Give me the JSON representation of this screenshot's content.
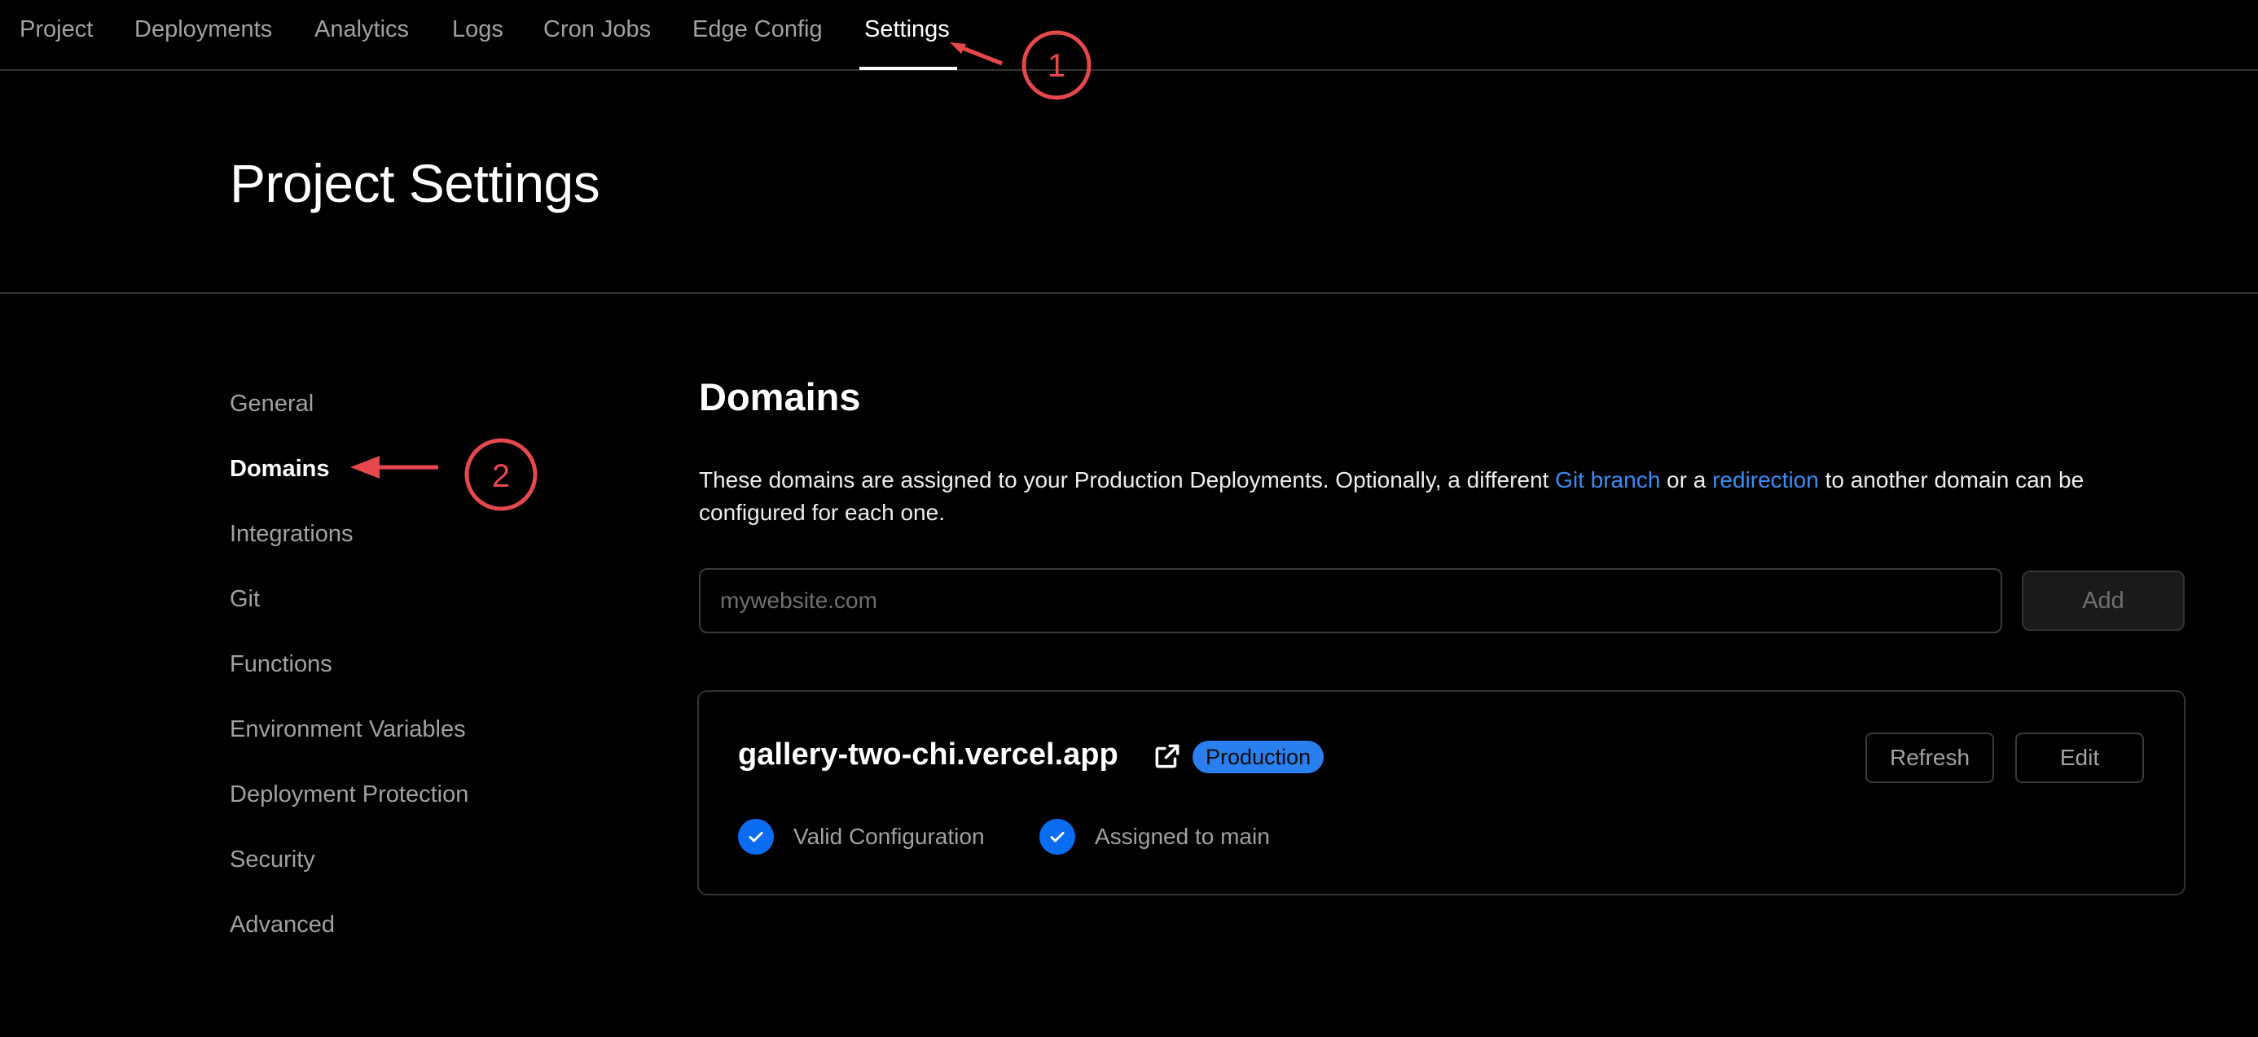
{
  "nav": {
    "tabs": [
      {
        "label": "Project"
      },
      {
        "label": "Deployments"
      },
      {
        "label": "Analytics"
      },
      {
        "label": "Logs"
      },
      {
        "label": "Cron Jobs"
      },
      {
        "label": "Edge Config"
      },
      {
        "label": "Settings",
        "active": true
      }
    ]
  },
  "header": {
    "title": "Project Settings"
  },
  "sidebar": {
    "items": [
      {
        "label": "General"
      },
      {
        "label": "Domains",
        "active": true
      },
      {
        "label": "Integrations"
      },
      {
        "label": "Git"
      },
      {
        "label": "Functions"
      },
      {
        "label": "Environment Variables"
      },
      {
        "label": "Deployment Protection"
      },
      {
        "label": "Security"
      },
      {
        "label": "Advanced"
      }
    ]
  },
  "domains": {
    "title": "Domains",
    "description": {
      "part1": "These domains are assigned to your Production Deployments. Optionally, a different ",
      "link1": "Git branch",
      "part2": " or a ",
      "link2": "redirection",
      "part3": " to another domain can be configured for each one."
    },
    "input_placeholder": "mywebsite.com",
    "add_label": "Add",
    "card": {
      "domain": "gallery-two-chi.vercel.app",
      "badge": "Production",
      "refresh_label": "Refresh",
      "edit_label": "Edit",
      "statuses": [
        {
          "label": "Valid Configuration"
        },
        {
          "label": "Assigned to main"
        }
      ]
    }
  },
  "annotations": [
    {
      "number": "1"
    },
    {
      "number": "2"
    }
  ],
  "colors": {
    "background": "#000000",
    "accent_link": "#3b8df5",
    "badge": "#2a7fef",
    "check": "#0a6cf0",
    "annotation": "#e5484d"
  }
}
